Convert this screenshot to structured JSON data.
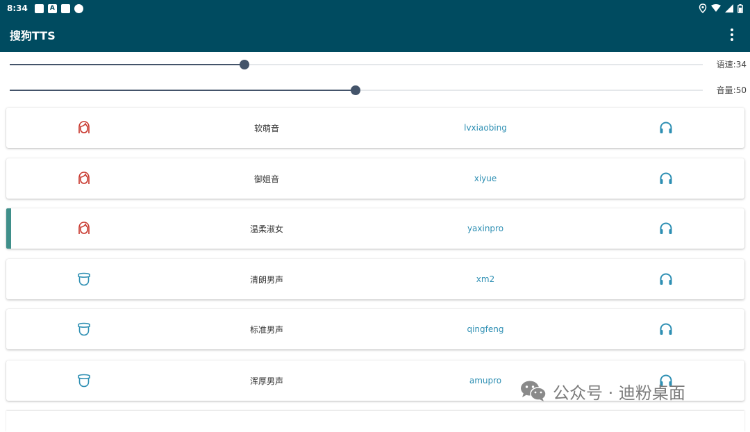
{
  "status_bar": {
    "time": "8:34"
  },
  "app_bar": {
    "title": "搜狗TTS"
  },
  "sliders": [
    {
      "label": "语速:34",
      "value": 34
    },
    {
      "label": "音量:50",
      "value": 50
    }
  ],
  "voices": [
    {
      "gender": "female",
      "name": "软萌音",
      "id": "lvxiaobing",
      "selected": false
    },
    {
      "gender": "female",
      "name": "御姐音",
      "id": "xiyue",
      "selected": false
    },
    {
      "gender": "female",
      "name": "温柔淑女",
      "id": "yaxinpro",
      "selected": true
    },
    {
      "gender": "male",
      "name": "清朗男声",
      "id": "xm2",
      "selected": false
    },
    {
      "gender": "male",
      "name": "标准男声",
      "id": "qingfeng",
      "selected": false
    },
    {
      "gender": "male",
      "name": "浑厚男声",
      "id": "amupro",
      "selected": false
    }
  ],
  "icons": {
    "female": "female-face-icon",
    "male": "male-face-icon",
    "play": "headphones-icon"
  },
  "colors": {
    "app_bar": "#004b60",
    "female_icon": "#c8372d",
    "male_icon": "#2e8fb3",
    "id_text": "#2e8fb3",
    "selected_bar": "#3f8f8a",
    "slider": "#44546a"
  },
  "watermark": {
    "text": "公众号 · 迪粉桌面"
  }
}
